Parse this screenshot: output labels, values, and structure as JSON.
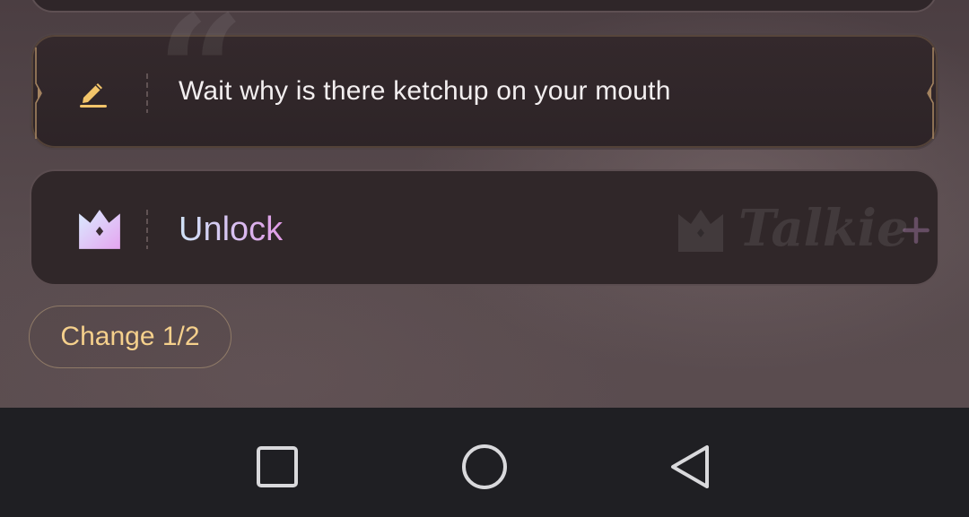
{
  "reply_card": {
    "text": "Wait why is there ketchup on your mouth",
    "icon": "pencil-icon"
  },
  "unlock_card": {
    "label": "Unlock",
    "icon": "crown-icon",
    "watermark": "Talkie"
  },
  "change_button": {
    "label": "Change 1/2"
  },
  "nav_bar": {
    "buttons": [
      "recents-button",
      "home-button",
      "back-button"
    ]
  },
  "colors": {
    "accent_gold": "#f5d08c",
    "nav_background": "#1f1f23"
  }
}
